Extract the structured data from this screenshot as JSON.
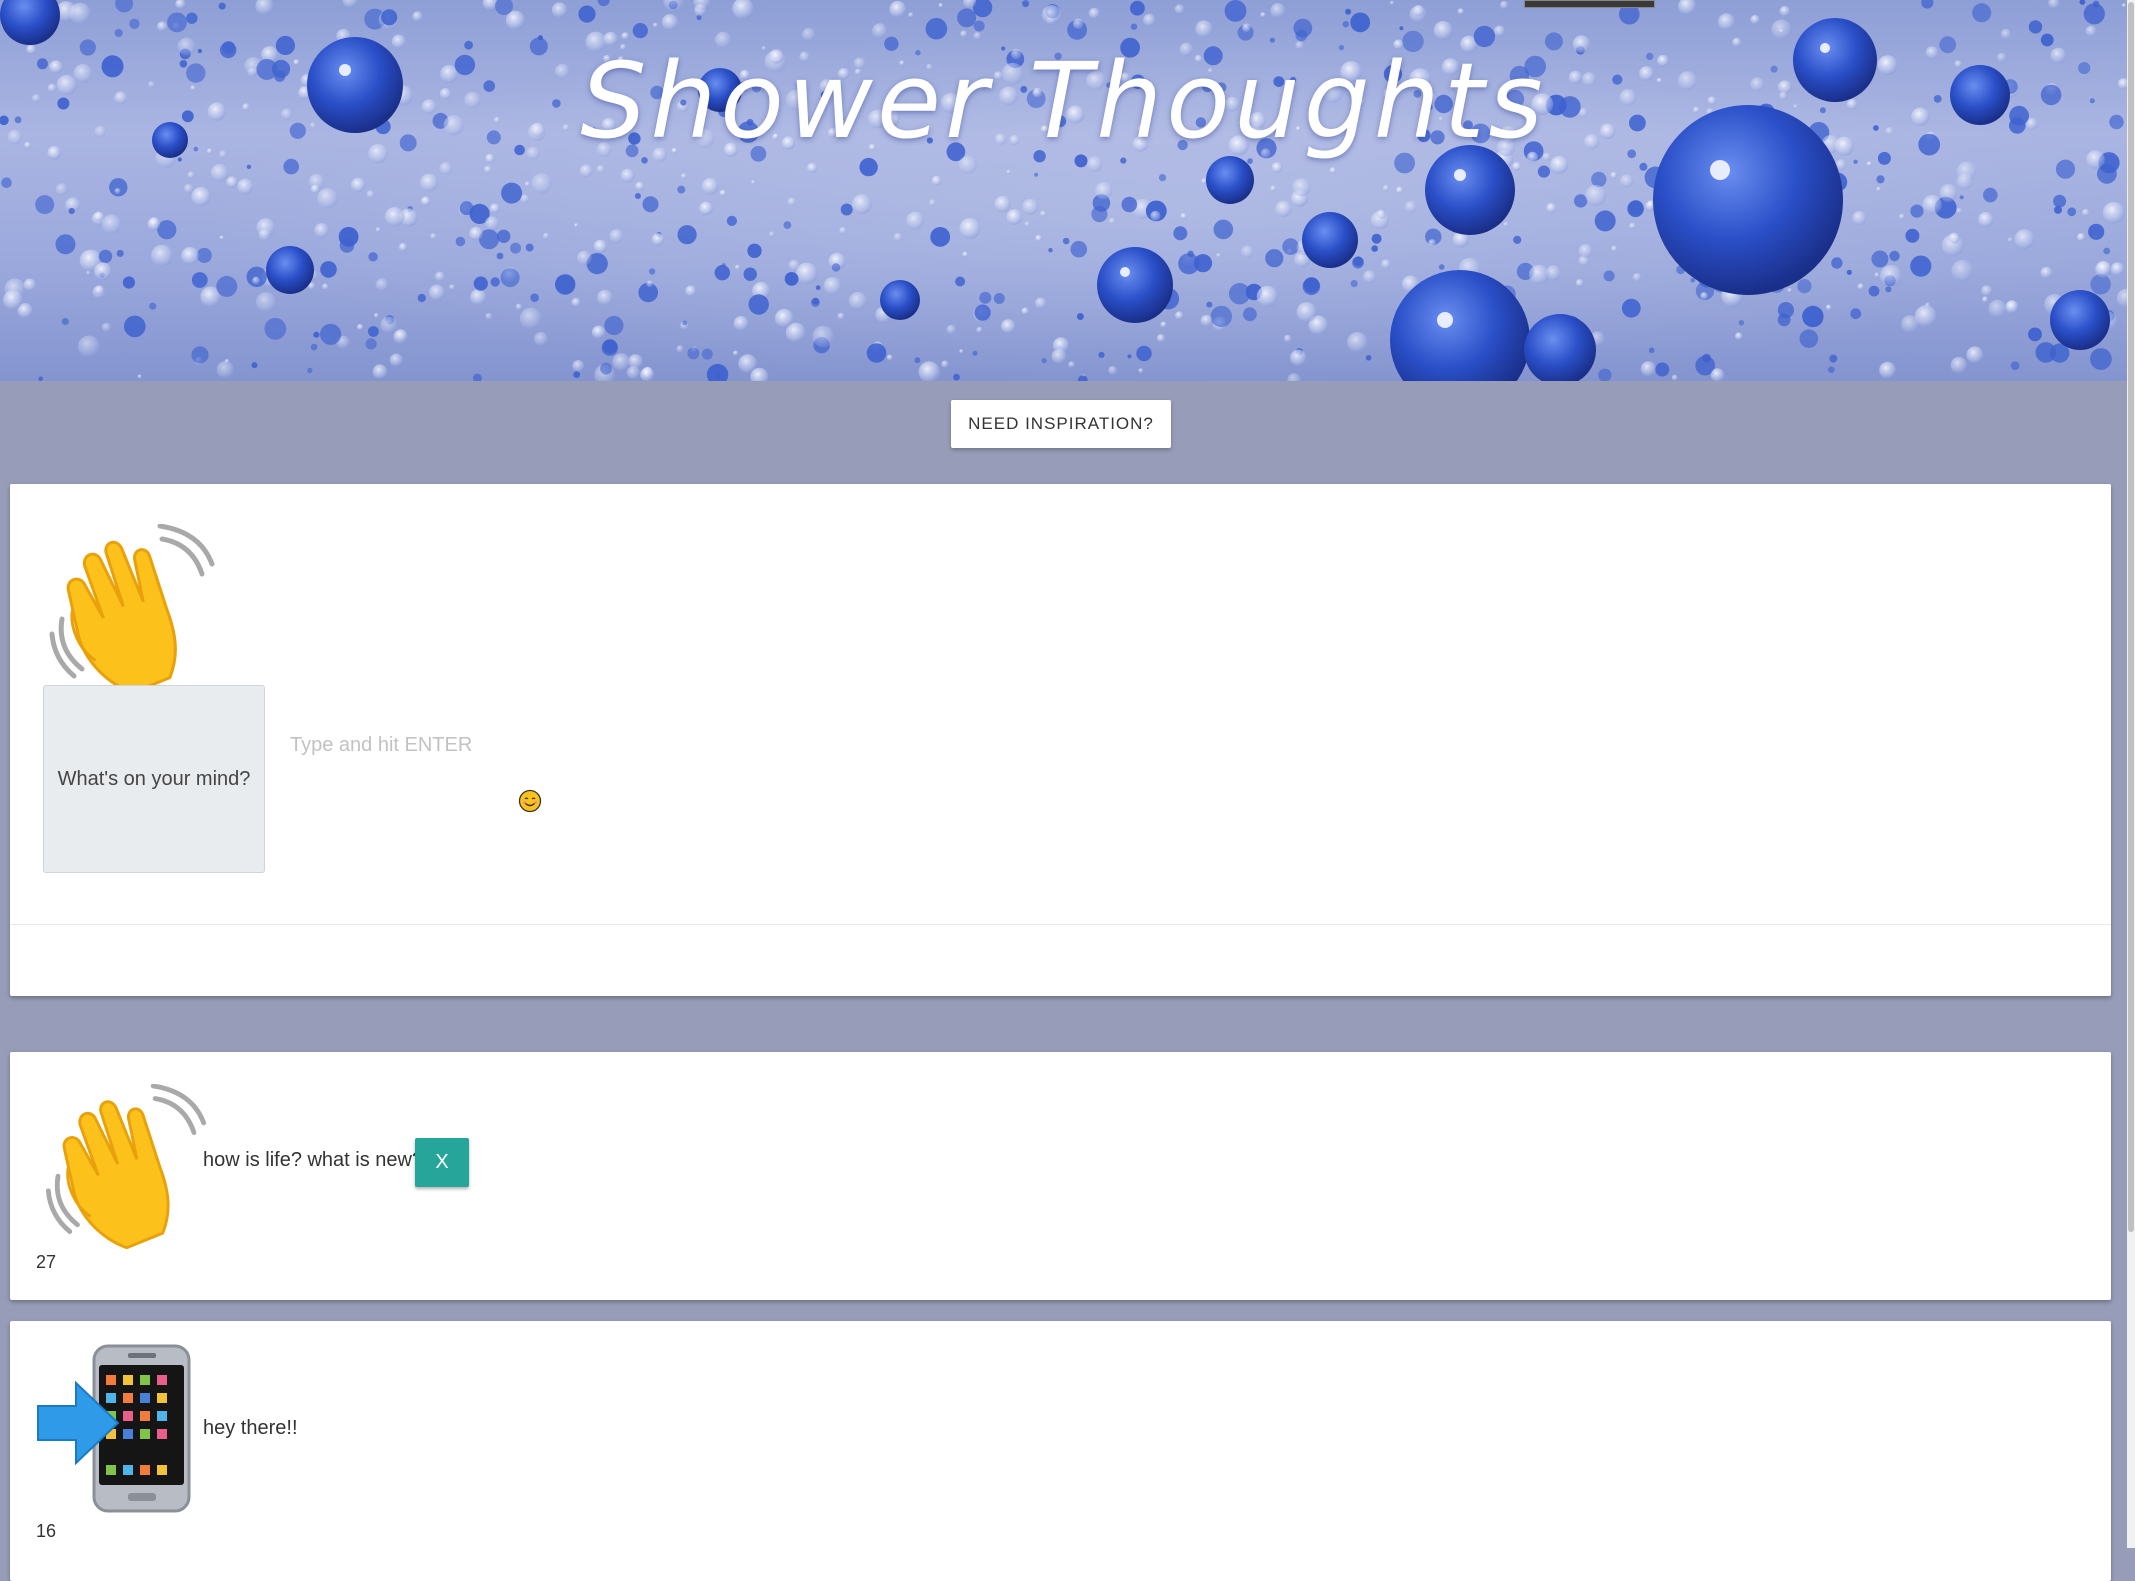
{
  "header": {
    "title": "Shower Thoughts"
  },
  "inspiration": {
    "button_label": "NEED INSPIRATION?"
  },
  "compose": {
    "emoji": "waving-hand",
    "prompt": "What's on your mind?",
    "input_placeholder": "Type and hit ENTER",
    "input_value": "",
    "emoji_picker_icon": "smiling-face-icon"
  },
  "posts": [
    {
      "emoji": "waving-hand",
      "text": "how is life? what is new?",
      "delete_label": "X",
      "count": "27"
    },
    {
      "emoji": "mobile-phone-with-arrow",
      "text": "hey there!!",
      "count": "16"
    }
  ],
  "colors": {
    "page_background": "#979db8",
    "card_background": "#ffffff",
    "delete_button": "#26a69a",
    "prompt_box": "#e9ecef"
  }
}
